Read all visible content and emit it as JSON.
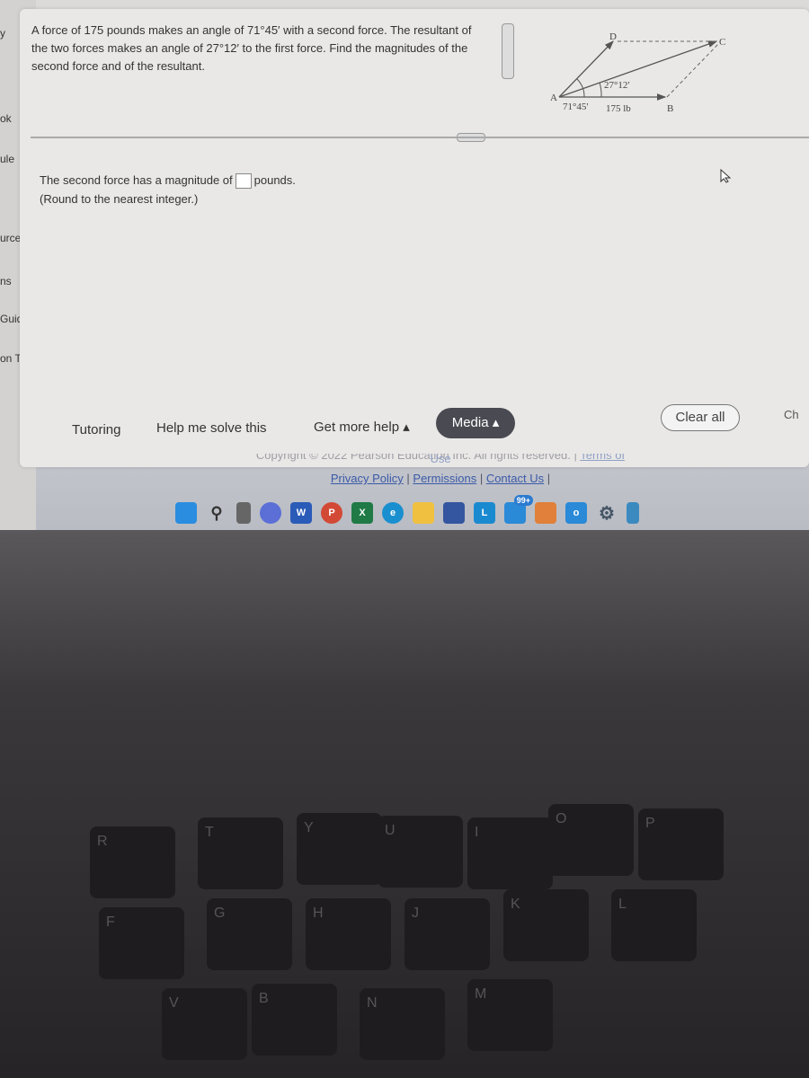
{
  "sidebar": {
    "items": [
      "y",
      "ok",
      "ule",
      "urces",
      "ns",
      "Guide",
      "on Tool"
    ]
  },
  "question": {
    "text": "A force of 175 pounds makes an angle of 71°45′ with a second force. The resultant of the two forces makes an angle of 27°12′ to the first force. Find the magnitudes of the second force and of the resultant."
  },
  "diagram": {
    "labels": {
      "a": "A",
      "b": "B",
      "c": "C",
      "d": "D",
      "angle1": "71°45′",
      "angle2": "27°12′",
      "force": "175 lb"
    }
  },
  "answer": {
    "prefix": "The second force has a magnitude of",
    "value": "",
    "suffix": "pounds.",
    "note": "(Round to the nearest integer.)"
  },
  "toolbar": {
    "tutoring": "Tutoring",
    "help": "Help me solve this",
    "more": "Get more help ▴",
    "media": "Media ▴",
    "clear": "Clear all",
    "check": "Ch"
  },
  "footer": {
    "copyright": "Copyright © 2022 Pearson Education Inc. All rights reserved. |",
    "terms": "Terms of Use",
    "privacy": "Privacy Policy",
    "permissions": "Permissions",
    "contact": "Contact Us"
  },
  "taskbar": {
    "icons": [
      "windows-start",
      "search",
      "task-view",
      "teams",
      "word",
      "powerpoint",
      "excel",
      "edge",
      "file-explorer",
      "store",
      "l-app",
      "mail",
      "app-orange",
      "cortana",
      "settings",
      "recycle"
    ],
    "mail_badge": "99+"
  },
  "keyboard": {
    "keys": [
      "R",
      "T",
      "Y",
      "U",
      "I",
      "O",
      "P",
      "F",
      "G",
      "H",
      "J",
      "K",
      "L",
      "V",
      "B",
      "N",
      "M"
    ]
  }
}
